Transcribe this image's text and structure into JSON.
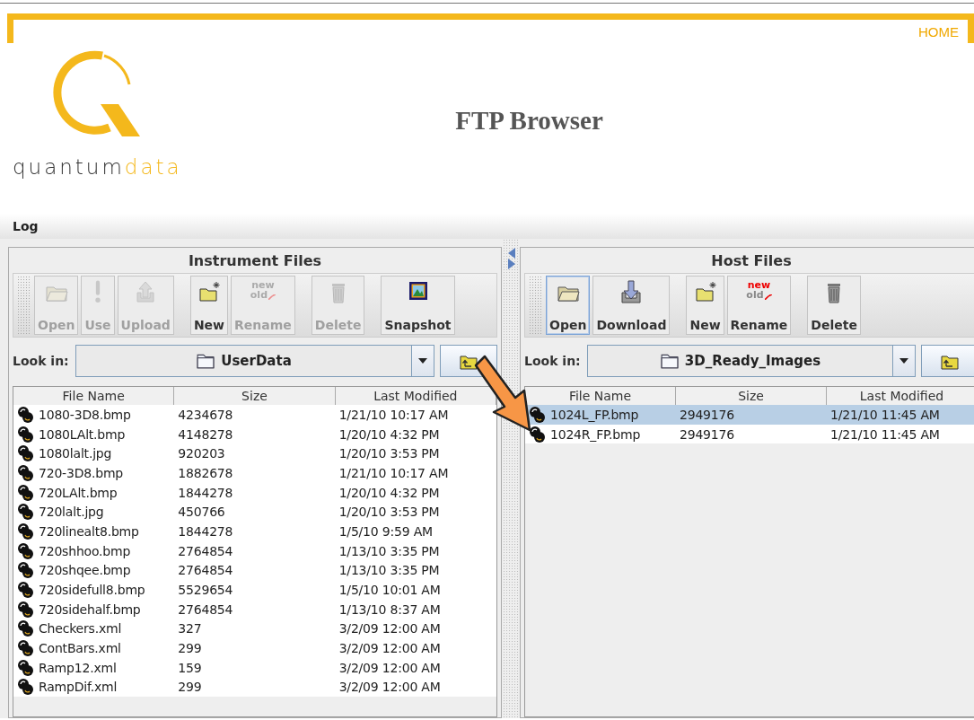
{
  "header": {
    "home_link": "HOME",
    "logo": [
      {
        "text": "quantum",
        "accent": false
      },
      {
        "text": "data",
        "accent": true
      }
    ],
    "title": "FTP Browser"
  },
  "log_bar": {
    "label": "Log"
  },
  "panels": [
    {
      "title": "Instrument Files",
      "button_groups": [
        [
          {
            "label": "Open",
            "kind": "open",
            "disabled": true,
            "focused": false
          },
          {
            "label": "Use",
            "kind": "use",
            "disabled": true,
            "focused": false
          },
          {
            "label": "Upload",
            "kind": "upload",
            "disabled": true,
            "focused": false
          }
        ],
        [
          {
            "label": "New",
            "kind": "new",
            "disabled": false,
            "focused": false
          },
          {
            "label": "Rename",
            "kind": "rename",
            "icon_words": [
              "new",
              "old"
            ],
            "disabled": true,
            "focused": false
          }
        ],
        [
          {
            "label": "Delete",
            "kind": "delete",
            "disabled": true,
            "focused": false
          }
        ],
        [
          {
            "label": "Snapshot",
            "kind": "snapshot",
            "disabled": false,
            "focused": false
          }
        ]
      ],
      "look_in": {
        "label": "Look in:",
        "value": "UserData"
      },
      "table": {
        "columns": [
          "File Name",
          "Size",
          "Last Modified"
        ],
        "rows": [
          {
            "cells": [
              "1080-3D8.bmp",
              "4234678",
              "1/21/10 10:17 AM"
            ],
            "selected": false
          },
          {
            "cells": [
              "1080LAlt.bmp",
              "4148278",
              "1/20/10 4:32 PM"
            ],
            "selected": false
          },
          {
            "cells": [
              "1080lalt.jpg",
              "920203",
              "1/20/10 3:53 PM"
            ],
            "selected": false
          },
          {
            "cells": [
              "720-3D8.bmp",
              "1882678",
              "1/21/10 10:17 AM"
            ],
            "selected": false
          },
          {
            "cells": [
              "720LAlt.bmp",
              "1844278",
              "1/20/10 4:32 PM"
            ],
            "selected": false
          },
          {
            "cells": [
              "720lalt.jpg",
              "450766",
              "1/20/10 3:53 PM"
            ],
            "selected": false
          },
          {
            "cells": [
              "720linealt8.bmp",
              "1844278",
              "1/5/10 9:59 AM"
            ],
            "selected": false
          },
          {
            "cells": [
              "720shhoo.bmp",
              "2764854",
              "1/13/10 3:35 PM"
            ],
            "selected": false
          },
          {
            "cells": [
              "720shqee.bmp",
              "2764854",
              "1/13/10 3:35 PM"
            ],
            "selected": false
          },
          {
            "cells": [
              "720sidefull8.bmp",
              "5529654",
              "1/5/10 10:01 AM"
            ],
            "selected": false
          },
          {
            "cells": [
              "720sidehalf.bmp",
              "2764854",
              "1/13/10 8:37 AM"
            ],
            "selected": false
          },
          {
            "cells": [
              "Checkers.xml",
              "327",
              "3/2/09 12:00 AM"
            ],
            "selected": false
          },
          {
            "cells": [
              "ContBars.xml",
              "299",
              "3/2/09 12:00 AM"
            ],
            "selected": false
          },
          {
            "cells": [
              "Ramp12.xml",
              "159",
              "3/2/09 12:00 AM"
            ],
            "selected": false
          },
          {
            "cells": [
              "RampDif.xml",
              "299",
              "3/2/09 12:00 AM"
            ],
            "selected": false
          }
        ]
      }
    },
    {
      "title": "Host Files",
      "button_groups": [
        [
          {
            "label": "Open",
            "kind": "open",
            "disabled": false,
            "focused": true
          },
          {
            "label": "Download",
            "kind": "download",
            "disabled": false,
            "focused": false
          }
        ],
        [
          {
            "label": "New",
            "kind": "new",
            "disabled": false,
            "focused": false
          },
          {
            "label": "Rename",
            "kind": "rename",
            "icon_words": [
              "new",
              "old"
            ],
            "disabled": false,
            "focused": false
          }
        ],
        [
          {
            "label": "Delete",
            "kind": "delete",
            "disabled": false,
            "focused": false
          }
        ]
      ],
      "look_in": {
        "label": "Look in:",
        "value": "3D_Ready_Images"
      },
      "table": {
        "columns": [
          "File Name",
          "Size",
          "Last Modified"
        ],
        "rows": [
          {
            "cells": [
              "1024L_FP.bmp",
              "2949176",
              "1/21/10 11:45 AM"
            ],
            "selected": true
          },
          {
            "cells": [
              "1024R_FP.bmp",
              "2949176",
              "1/21/10 11:45 AM"
            ],
            "selected": false
          }
        ]
      }
    }
  ]
}
